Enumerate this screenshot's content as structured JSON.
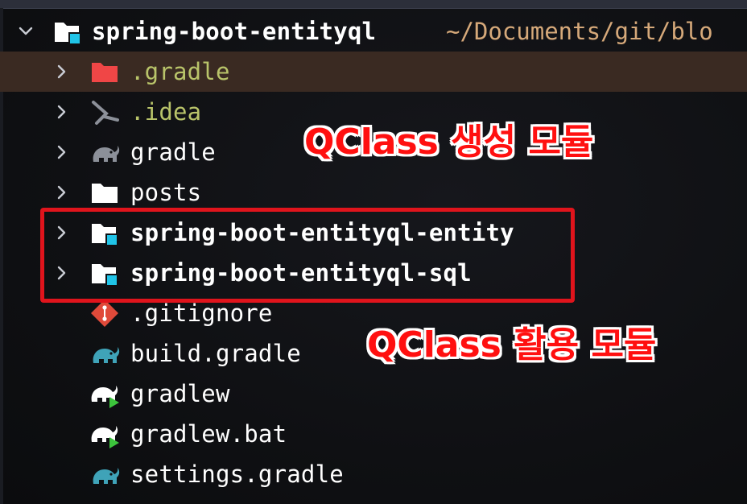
{
  "project": {
    "name": "spring-boot-entityql",
    "path": "~/Documents/git/blo"
  },
  "tree": [
    {
      "label": ".gradle",
      "icon": "folder-red-icon",
      "expandable": true,
      "selected": true
    },
    {
      "label": ".idea",
      "icon": "idea-icon",
      "expandable": true
    },
    {
      "label": "gradle",
      "icon": "gradle-elephant-icon",
      "expandable": true
    },
    {
      "label": "posts",
      "icon": "folder-icon",
      "expandable": true
    },
    {
      "label": "spring-boot-entityql-entity",
      "icon": "module-folder-icon",
      "expandable": true
    },
    {
      "label": "spring-boot-entityql-sql",
      "icon": "module-folder-icon",
      "expandable": true
    },
    {
      "label": ".gitignore",
      "icon": "git-icon",
      "expandable": false
    },
    {
      "label": "build.gradle",
      "icon": "gradle-elephant-icon",
      "expandable": false
    },
    {
      "label": "gradlew",
      "icon": "gradle-run-icon",
      "expandable": false
    },
    {
      "label": "gradlew.bat",
      "icon": "gradle-run-icon",
      "expandable": false
    },
    {
      "label": "settings.gradle",
      "icon": "gradle-elephant-icon",
      "expandable": false
    }
  ],
  "annotations": {
    "generate": "QClass 생성 모듈",
    "use": "QClass 활용 모듈"
  },
  "colors": {
    "annotation": "#ff1010",
    "box": "#e0141c",
    "selected_row": "#3a2a22",
    "path": "#d6a97a",
    "green_label": "#b9c46a",
    "module_accent": "#20c4e8"
  }
}
